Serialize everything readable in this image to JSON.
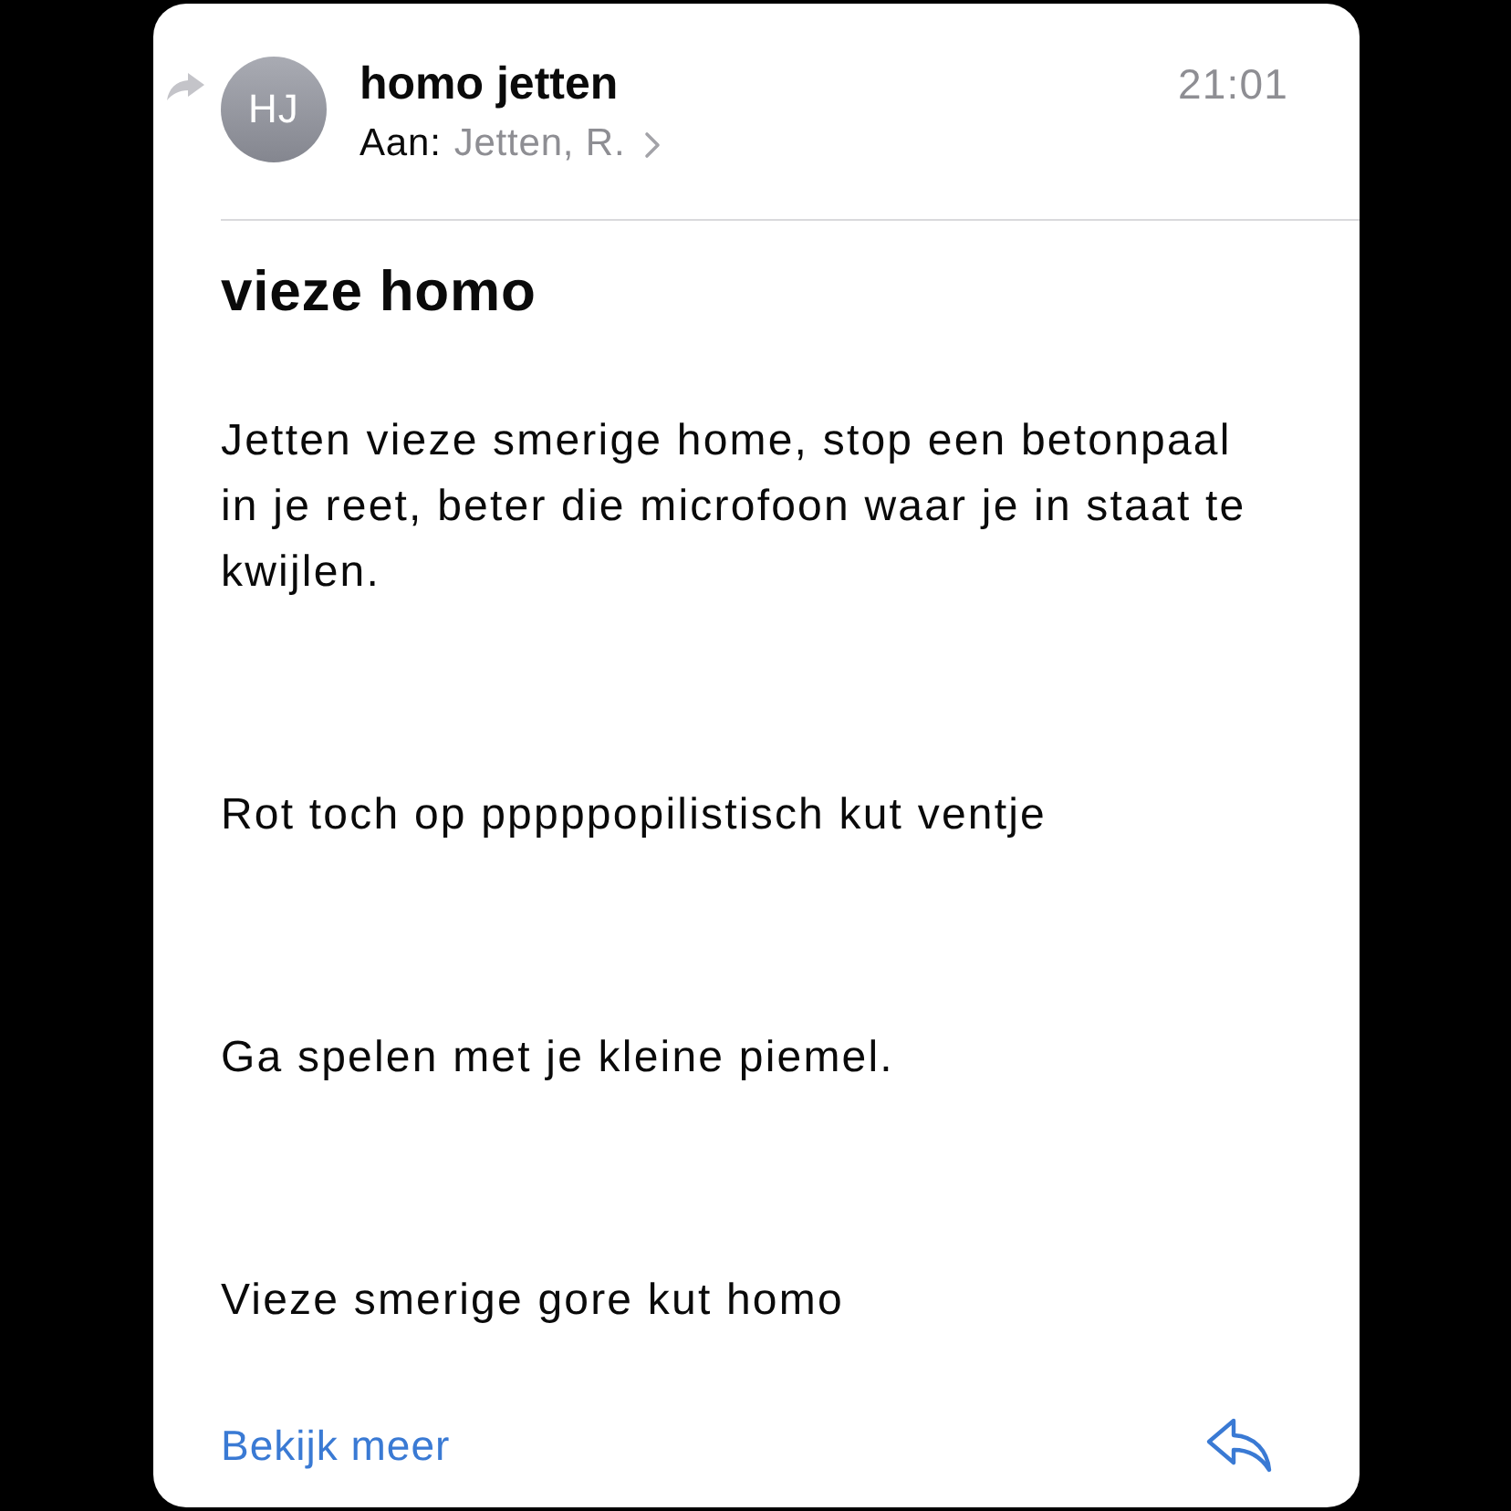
{
  "message": {
    "forwarded": true,
    "sender": {
      "initials": "HJ",
      "name": "homo jetten"
    },
    "recipient_label": "Aan:",
    "recipient": "Jetten, R.",
    "time": "21:01",
    "subject": "vieze homo",
    "body": [
      "Jetten vieze smerige home, stop een betonpaal in je reet, beter die microfoon waar je in staat te kwijlen.",
      "Rot toch op pppppopilistisch kut ventje",
      "Ga spelen met je kleine piemel.",
      "Vieze smerige gore kut homo"
    ]
  },
  "footer": {
    "link": "Bekijk meer"
  }
}
